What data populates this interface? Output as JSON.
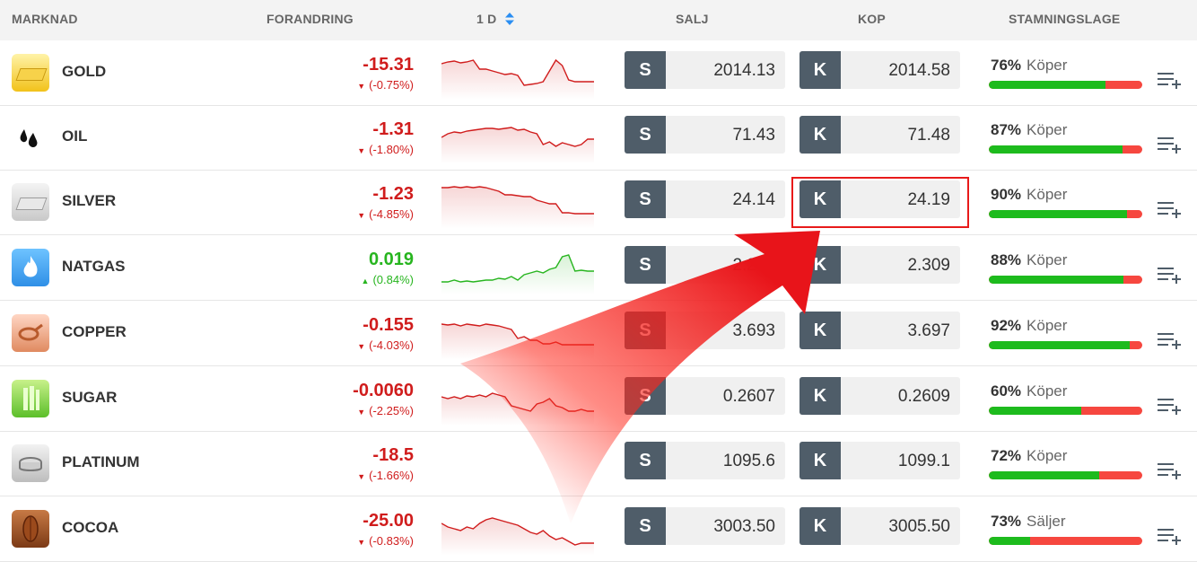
{
  "header": {
    "market": "MARKNAD",
    "change": "FORANDRING",
    "period": "1 D",
    "sell": "SALJ",
    "buy": "KOP",
    "sentiment": "STAMNINGSLAGE"
  },
  "colors": {
    "negative": "#d01c1c",
    "positive": "#27b51f",
    "buy_bar": "#1dbb1d",
    "sell_bar": "#f6473f",
    "button_tag": "#4f5d69",
    "highlight": "#e81a1a"
  },
  "rows": [
    {
      "name": "GOLD",
      "icon": "gold-bar-icon",
      "change": "-15.31",
      "change_pct": "(-0.75%)",
      "trend": "down",
      "sell_label": "S",
      "sell": "2014.13",
      "buy_label": "K",
      "buy": "2014.58",
      "sentiment_pct": "76%",
      "sentiment_label": "Köper",
      "buy_share": 0.76,
      "spark": [
        20,
        18,
        17,
        19,
        18,
        16,
        26,
        26,
        28,
        30,
        32,
        31,
        33,
        44,
        43,
        42,
        40,
        28,
        16,
        22,
        38,
        40,
        40,
        40,
        40
      ]
    },
    {
      "name": "OIL",
      "icon": "oil-drops-icon",
      "change": "-1.31",
      "change_pct": "(-1.80%)",
      "trend": "down",
      "sell_label": "S",
      "sell": "71.43",
      "buy_label": "K",
      "buy": "71.48",
      "sentiment_pct": "87%",
      "sentiment_label": "Köper",
      "buy_share": 0.87,
      "spark": [
        30,
        26,
        24,
        25,
        23,
        22,
        21,
        20,
        20,
        21,
        20,
        19,
        22,
        21,
        24,
        26,
        38,
        35,
        40,
        36,
        38,
        40,
        38,
        32,
        32
      ]
    },
    {
      "name": "SILVER",
      "icon": "silver-bar-icon",
      "change": "-1.23",
      "change_pct": "(-4.85%)",
      "trend": "down",
      "sell_label": "S",
      "sell": "24.14",
      "buy_label": "K",
      "buy": "24.19",
      "sentiment_pct": "90%",
      "sentiment_label": "Köper",
      "buy_share": 0.9,
      "spark": [
        14,
        14,
        13,
        14,
        13,
        14,
        13,
        14,
        16,
        18,
        22,
        22,
        23,
        24,
        24,
        28,
        30,
        32,
        32,
        42,
        42,
        43,
        43,
        43,
        43
      ]
    },
    {
      "name": "NATGAS",
      "icon": "flame-icon",
      "change": "0.019",
      "change_pct": "(0.84%)",
      "trend": "up",
      "sell_label": "S",
      "sell": "2.290",
      "buy_label": "K",
      "buy": "2.309",
      "sentiment_pct": "88%",
      "sentiment_label": "Köper",
      "buy_share": 0.88,
      "spark": [
        46,
        46,
        44,
        46,
        45,
        46,
        45,
        44,
        44,
        42,
        43,
        40,
        44,
        38,
        36,
        34,
        36,
        32,
        30,
        18,
        16,
        34,
        33,
        34,
        34
      ]
    },
    {
      "name": "COPPER",
      "icon": "copper-wire-icon",
      "change": "-0.155",
      "change_pct": "(-4.03%)",
      "trend": "down",
      "sell_label": "S",
      "sell": "3.693",
      "buy_label": "K",
      "buy": "3.697",
      "sentiment_pct": "92%",
      "sentiment_label": "Köper",
      "buy_share": 0.92,
      "spark": [
        20,
        21,
        20,
        22,
        20,
        21,
        22,
        20,
        21,
        22,
        24,
        26,
        36,
        34,
        38,
        38,
        42,
        42,
        40,
        43,
        43,
        43,
        43,
        43,
        43
      ]
    },
    {
      "name": "SUGAR",
      "icon": "sugarcane-icon",
      "change": "-0.0060",
      "change_pct": "(-2.25%)",
      "trend": "down",
      "sell_label": "S",
      "sell": "0.2607",
      "buy_label": "K",
      "buy": "0.2609",
      "sentiment_pct": "60%",
      "sentiment_label": "Köper",
      "buy_share": 0.6,
      "spark": [
        28,
        30,
        28,
        30,
        27,
        28,
        26,
        28,
        24,
        26,
        28,
        38,
        40,
        42,
        44,
        36,
        34,
        30,
        38,
        40,
        44,
        44,
        42,
        44,
        44
      ]
    },
    {
      "name": "PLATINUM",
      "icon": "platinum-ring-icon",
      "change": "-18.5",
      "change_pct": "(-1.66%)",
      "trend": "down",
      "sell_label": "S",
      "sell": "1095.6",
      "buy_label": "K",
      "buy": "1099.1",
      "sentiment_pct": "72%",
      "sentiment_label": "Köper",
      "buy_share": 0.72,
      "spark": []
    },
    {
      "name": "COCOA",
      "icon": "cocoa-pod-icon",
      "change": "-25.00",
      "change_pct": "(-0.83%)",
      "trend": "down",
      "sell_label": "S",
      "sell": "3003.50",
      "buy_label": "K",
      "buy": "3005.50",
      "sentiment_pct": "73%",
      "sentiment_label": "Säljer",
      "buy_share": 0.27,
      "spark": [
        24,
        28,
        30,
        32,
        28,
        30,
        24,
        20,
        18,
        20,
        22,
        24,
        26,
        30,
        34,
        36,
        32,
        38,
        42,
        40,
        44,
        48,
        46,
        46,
        46
      ]
    }
  ]
}
